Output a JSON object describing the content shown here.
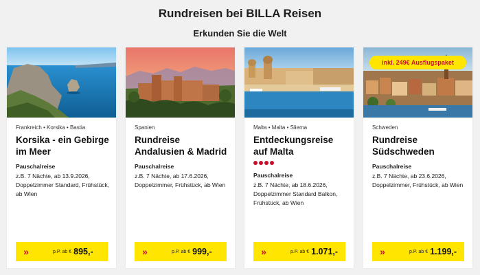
{
  "header": {
    "title": "Rundreisen bei BILLA Reisen",
    "subtitle": "Erkunden Sie die Welt"
  },
  "colors": {
    "accent_yellow": "#ffe500",
    "accent_red": "#c8102e",
    "background": "#f1f1f1"
  },
  "cards": [
    {
      "location": "Frankreich • Korsika • Bastia",
      "title": "Korsika - ein Gebirge im Meer",
      "type": "Pauschalreise",
      "details": "z.B. 7 Nächte, ab 13.9.2026, Doppelzimmer Standard, Frühstück, ab Wien",
      "price_prefix": "p.P. ab €",
      "price": "895,-",
      "image_icon": "corsica-coast-photo"
    },
    {
      "location": "Spanien",
      "title": "Rundreise Andalusien & Madrid",
      "type": "Pauschalreise",
      "details": "z.B. 7 Nächte, ab 17.6.2026, Doppelzimmer, Frühstück, ab Wien",
      "price_prefix": "p.P. ab €",
      "price": "999,-",
      "image_icon": "alhambra-photo"
    },
    {
      "location": "Malta • Malta • Sliema",
      "title": "Entdeckungsreise auf Malta",
      "rating": 4,
      "type": "Pauschalreise",
      "details": "z.B. 7 Nächte, ab 18.6.2026, Doppelzimmer Standard Balkon, Frühstück, ab Wien",
      "price_prefix": "p.P. ab €",
      "price": "1.071,-",
      "image_icon": "valletta-harbour-photo"
    },
    {
      "location": "Schweden",
      "title": "Rundreise Südschweden",
      "badge": "inkl. 249€ Ausflugspaket",
      "type": "Pauschalreise",
      "details": "z.B. 7 Nächte, ab 23.6.2026, Doppelzimmer, Frühstück, ab Wien",
      "price_prefix": "p.P. ab €",
      "price": "1.199,-",
      "image_icon": "stockholm-city-photo"
    }
  ]
}
